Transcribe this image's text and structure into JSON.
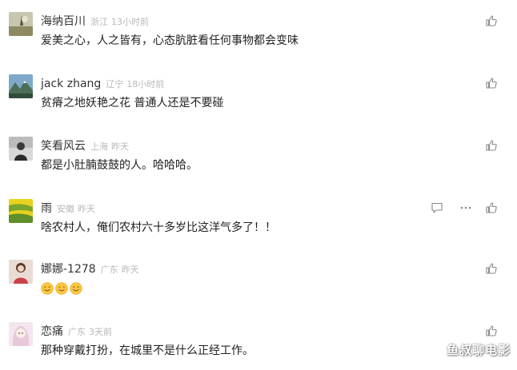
{
  "comments": [
    {
      "username": "海纳百川",
      "location": "浙江",
      "time": "13小时前",
      "content": "爱美之心，人之皆有，心态肮脏看任何事物都会变味",
      "avatar": "landscape-avatar"
    },
    {
      "username": "jack zhang",
      "location": "辽宁",
      "time": "18小时前",
      "content": "贫瘠之地妖艳之花 普通人还是不要碰",
      "avatar": "mountain-avatar"
    },
    {
      "username": "笑看风云",
      "location": "上海",
      "time": "昨天",
      "content": "都是小肚腩鼓鼓的人。哈哈哈。",
      "avatar": "person-avatar"
    },
    {
      "username": "雨",
      "location": "安徽",
      "time": "昨天",
      "content": "啥农村人，俺们农村六十多岁比这洋气多了！！",
      "avatar": "field-avatar"
    },
    {
      "username": "娜娜-1278",
      "location": "广东",
      "time": "昨天",
      "content": "",
      "avatar": "girl-avatar",
      "emojis": [
        "smile-emoji",
        "smile-emoji",
        "smile-emoji"
      ]
    },
    {
      "username": "恋痛",
      "location": "广东",
      "time": "3天前",
      "content": "那种穿戴打扮，在城里不是什么正经工作。",
      "avatar": "anime-avatar"
    }
  ],
  "watermark": "鱼叔聊电影",
  "colors": {
    "meta_gray": "#b8b8b8",
    "text": "#222222",
    "icon_gray": "#999999"
  }
}
